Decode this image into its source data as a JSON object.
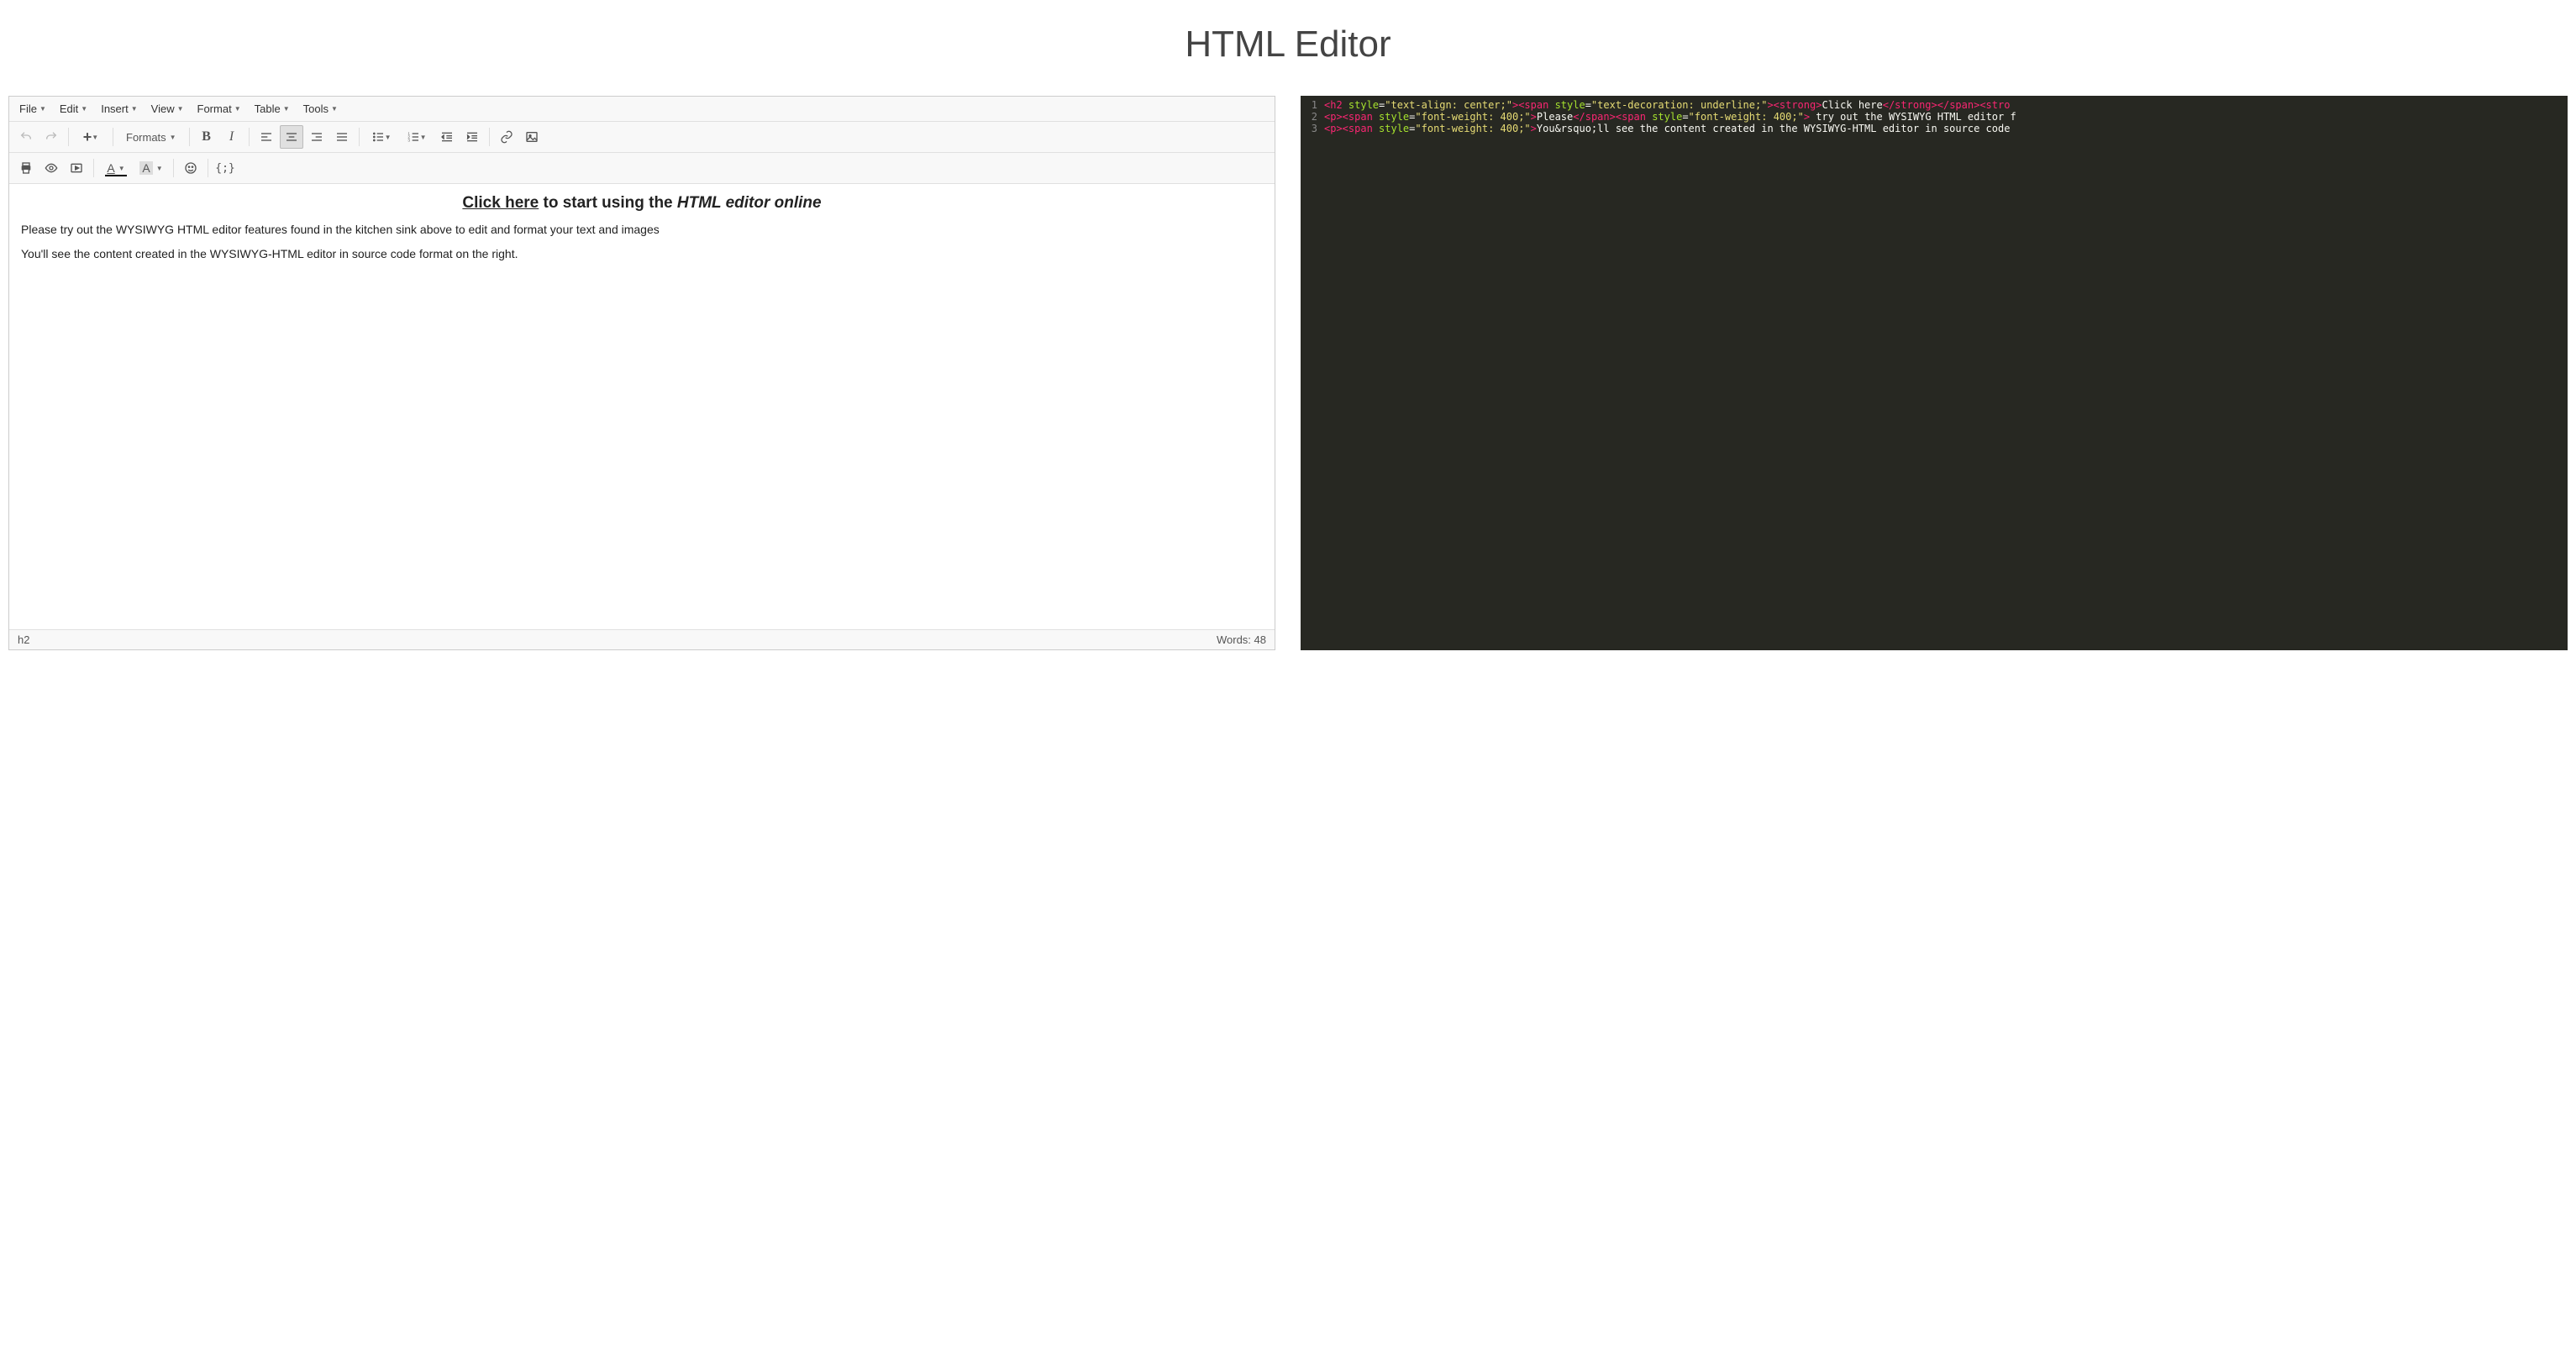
{
  "page_title": "HTML Editor",
  "menubar": {
    "file": "File",
    "edit": "Edit",
    "insert": "Insert",
    "view": "View",
    "format": "Format",
    "table": "Table",
    "tools": "Tools"
  },
  "toolbar": {
    "formats_label": "Formats",
    "new_plus": "+"
  },
  "content": {
    "heading_click": "Click here",
    "heading_mid": " to start using the ",
    "heading_ital": "HTML editor online",
    "para1": "Please try out the WYSIWYG HTML editor features found in the kitchen sink above to edit and format your text and images",
    "para2": "You'll see the content created in the WYSIWYG-HTML editor in source code format on the right."
  },
  "statusbar": {
    "path": "h2",
    "words_label": "Words: ",
    "words_count": "48"
  },
  "code": {
    "lines": [
      {
        "n": "1",
        "tokens": [
          {
            "c": "tag",
            "t": "<h2 "
          },
          {
            "c": "attr",
            "t": "style"
          },
          {
            "c": "op",
            "t": "="
          },
          {
            "c": "str",
            "t": "\"text-align: center;\""
          },
          {
            "c": "tag",
            "t": "><span "
          },
          {
            "c": "attr",
            "t": "style"
          },
          {
            "c": "op",
            "t": "="
          },
          {
            "c": "str",
            "t": "\"text-decoration: underline;\""
          },
          {
            "c": "tag",
            "t": "><strong>"
          },
          {
            "c": "txt",
            "t": "Click here"
          },
          {
            "c": "tag",
            "t": "</strong></span><stro"
          }
        ]
      },
      {
        "n": "2",
        "tokens": [
          {
            "c": "tag",
            "t": "<p><span "
          },
          {
            "c": "attr",
            "t": "style"
          },
          {
            "c": "op",
            "t": "="
          },
          {
            "c": "str",
            "t": "\"font-weight: 400;\""
          },
          {
            "c": "tag",
            "t": ">"
          },
          {
            "c": "txt",
            "t": "Please"
          },
          {
            "c": "tag",
            "t": "</span><span "
          },
          {
            "c": "attr",
            "t": "style"
          },
          {
            "c": "op",
            "t": "="
          },
          {
            "c": "str",
            "t": "\"font-weight: 400;\""
          },
          {
            "c": "tag",
            "t": ">"
          },
          {
            "c": "txt",
            "t": " try out the WYSIWYG HTML editor f"
          }
        ]
      },
      {
        "n": "3",
        "tokens": [
          {
            "c": "tag",
            "t": "<p><span "
          },
          {
            "c": "attr",
            "t": "style"
          },
          {
            "c": "op",
            "t": "="
          },
          {
            "c": "str",
            "t": "\"font-weight: 400;\""
          },
          {
            "c": "tag",
            "t": ">"
          },
          {
            "c": "txt",
            "t": "You&rsquo;ll see the content created in the WYSIWYG-HTML editor in source code "
          }
        ]
      }
    ]
  }
}
